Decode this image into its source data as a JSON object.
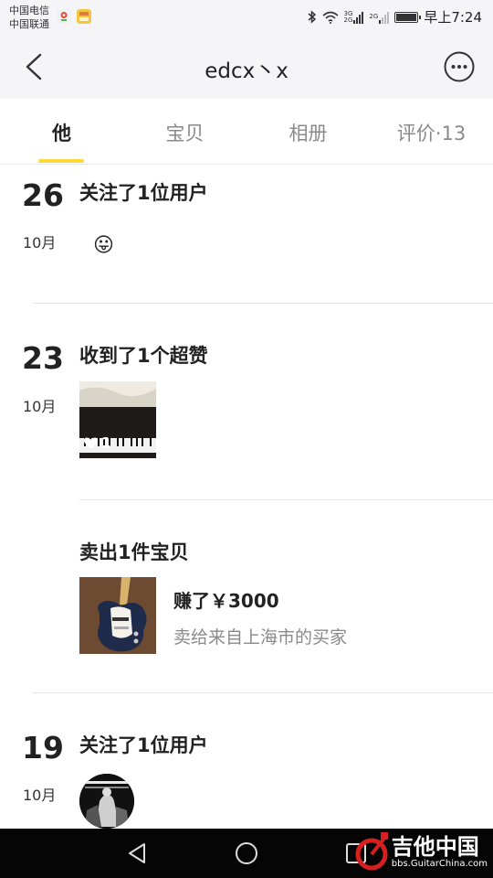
{
  "status_bar": {
    "carrier_1": "中国电信",
    "carrier_2": "中国联通",
    "network_1": "3G",
    "network_2": "2G",
    "network_3": "2G",
    "time": "早上7:24",
    "icons": [
      "maps-icon",
      "app-icon",
      "bluetooth-icon",
      "wifi-icon",
      "signal-icon",
      "battery-icon"
    ]
  },
  "header": {
    "title": "edcx丶x",
    "back_icon": "chevron-left-icon",
    "more_icon": "more-dots-icon"
  },
  "tabs": [
    {
      "label": "他",
      "active": true
    },
    {
      "label": "宝贝",
      "active": false
    },
    {
      "label": "相册",
      "active": false
    },
    {
      "label": "评价·13",
      "active": false
    }
  ],
  "feed": [
    {
      "day": "26",
      "month": "10月",
      "title": "关注了1位用户",
      "emoji": "😛"
    },
    {
      "day": "23",
      "month": "10月",
      "title": "收到了1个超赞",
      "likes": "1"
    },
    {
      "title": "卖出1件宝贝",
      "earned": "赚了￥3000",
      "buyer": "卖给来自上海市的买家"
    },
    {
      "day": "19",
      "month": "10月",
      "title": "关注了1位用户"
    }
  ],
  "nav_bar": {
    "buttons": [
      "back-triangle-icon",
      "home-circle-icon",
      "recents-square-icon"
    ]
  },
  "watermark": {
    "title": "吉他中国",
    "site": "bbs.GuitarChina.com"
  },
  "colors": {
    "accent": "#ffd83a",
    "header_bg": "#f5f5f7",
    "muted_text": "#8a8a8a"
  }
}
